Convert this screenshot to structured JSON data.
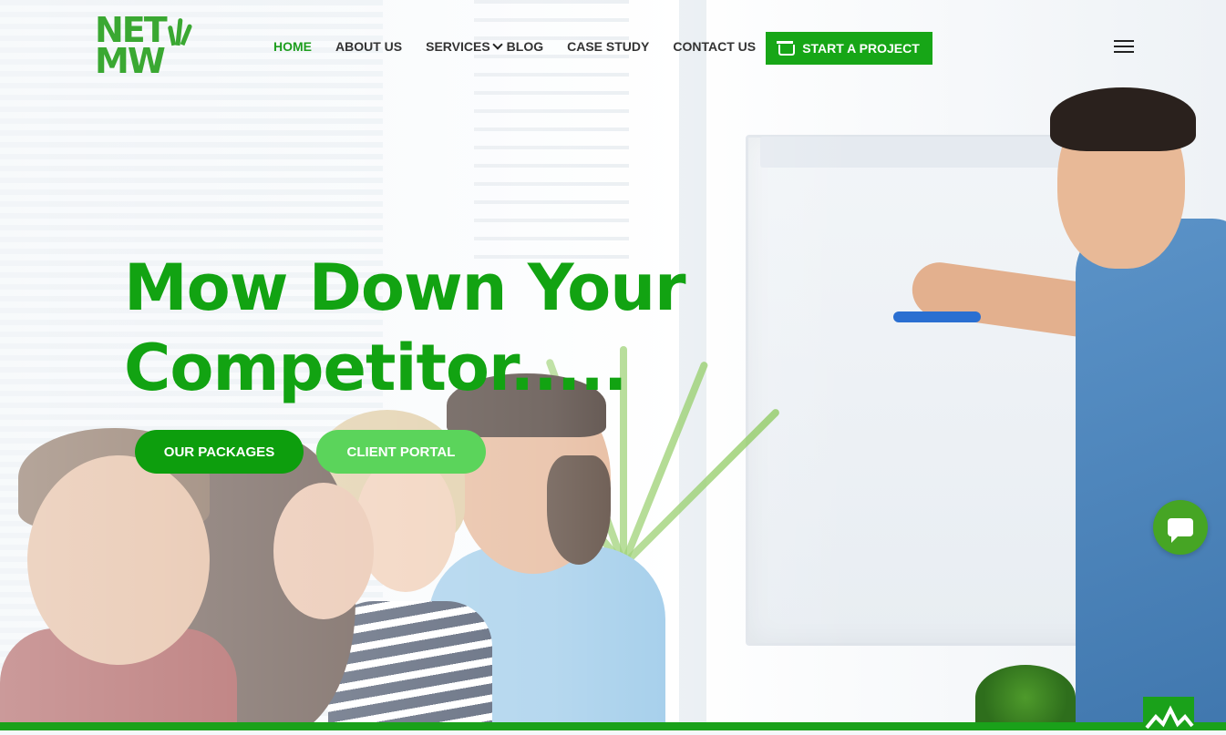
{
  "header": {
    "logo": {
      "line1": "NET",
      "line2": "MW"
    },
    "nav": [
      {
        "label": "HOME",
        "active": true
      },
      {
        "label": "ABOUT US"
      },
      {
        "label": "SERVICES",
        "has_dropdown": true
      },
      {
        "label": "BLOG"
      },
      {
        "label": "CASE STUDY"
      },
      {
        "label": "CONTACT US"
      }
    ],
    "cta_label": "START A PROJECT",
    "cta_icon": "basket-icon",
    "menu_icon": "hamburger-icon"
  },
  "hero": {
    "headline_line1": "Mow Down Your",
    "headline_line2": "Competitor.....",
    "buttons": [
      {
        "label": "OUR PACKAGES"
      },
      {
        "label": "CLIENT PORTAL"
      }
    ]
  },
  "widgets": {
    "chat_icon": "chat-bubble-icon",
    "scroll_top_icon": "scroll-to-top-icon"
  },
  "colors": {
    "brand_green": "#12a312",
    "cta_green": "#17a617",
    "light_green": "#5bd45b",
    "chat_green": "#46a524",
    "nav_text": "#333333"
  }
}
